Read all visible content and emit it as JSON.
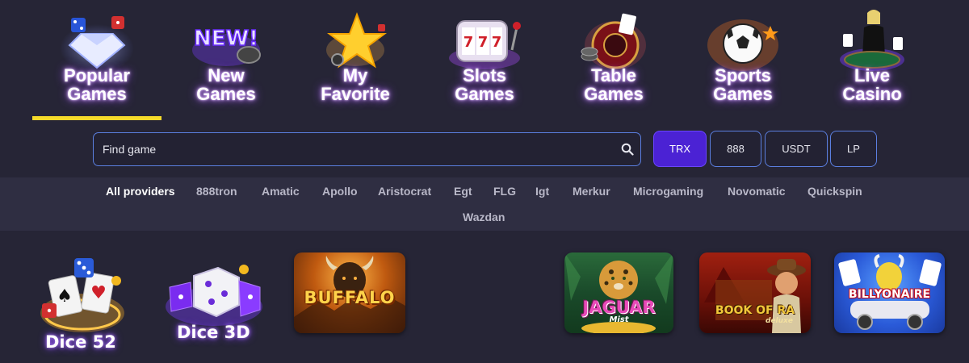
{
  "categories": [
    {
      "line1": "Popular",
      "line2": "Games",
      "icon": "diamond-dice-icon",
      "active": true
    },
    {
      "line1": "New",
      "line2": "Games",
      "icon": "new-badge-icon",
      "active": false
    },
    {
      "line1": "My",
      "line2": "Favorite",
      "icon": "star-icon",
      "active": false
    },
    {
      "line1": "Slots",
      "line2": "Games",
      "icon": "slot-machine-icon",
      "active": false
    },
    {
      "line1": "Table",
      "line2": "Games",
      "icon": "roulette-icon",
      "active": false
    },
    {
      "line1": "Sports",
      "line2": "Games",
      "icon": "soccer-ball-icon",
      "active": false
    },
    {
      "line1": "Live",
      "line2": "Casino",
      "icon": "live-dealer-icon",
      "active": false
    }
  ],
  "search": {
    "placeholder": "Find game",
    "icon": "search-icon"
  },
  "currencies": [
    {
      "label": "TRX",
      "active": true
    },
    {
      "label": "888",
      "active": false
    },
    {
      "label": "USDT",
      "active": false
    },
    {
      "label": "LP",
      "active": false
    }
  ],
  "providers": [
    "All providers",
    "888tron",
    "Amatic",
    "Apollo",
    "Aristocrat",
    "Egt",
    "FLG",
    "Igt",
    "Merkur",
    "Microgaming",
    "Novomatic",
    "Quickspin",
    "Wazdan"
  ],
  "games": {
    "dice52": {
      "label": "Dice 52"
    },
    "dice3d": {
      "label": "Dice 3D"
    },
    "buffalo": {
      "title": "BUFFALO"
    },
    "jaguar": {
      "title": "JAGUAR",
      "subtitle": "Mist"
    },
    "bookofra": {
      "title": "BOOK OF RA",
      "subtitle": "deluxe"
    },
    "billyonaire": {
      "title": "BILLYONAIRE"
    }
  },
  "colors": {
    "background": "#262536",
    "provider_bar": "#2f2e42",
    "active_underline": "#f5da2a",
    "active_currency": "#4b22d4",
    "border_accent": "#5b7fe0"
  }
}
